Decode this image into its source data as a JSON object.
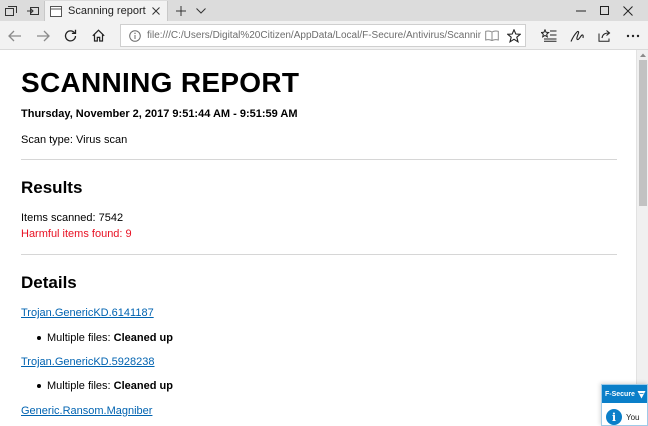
{
  "browser": {
    "tab_title": "Scanning report",
    "address_url": "file:///C:/Users/Digital%20Citizen/AppData/Local/F-Secure/Antivirus/ScanningReports/scan_"
  },
  "report": {
    "title": "SCANNING REPORT",
    "datetime": "Thursday, November 2, 2017 9:51:44 AM - 9:51:59 AM",
    "scan_type": "Scan type: Virus scan",
    "results": {
      "heading": "Results",
      "items_scanned": "Items scanned: 7542",
      "harmful_items": "Harmful items found: 9"
    },
    "details": {
      "heading": "Details",
      "threats": [
        {
          "name": "Trojan.GenericKD.6141187",
          "files_label": "Multiple files: ",
          "action": "Cleaned up"
        },
        {
          "name": "Trojan.GenericKD.5928238",
          "files_label": "Multiple files: ",
          "action": "Cleaned up"
        },
        {
          "name": "Generic.Ransom.Magniber"
        }
      ]
    }
  },
  "toast": {
    "brand": "F-Secure",
    "text": "You"
  },
  "colors": {
    "harmful": "#e81123",
    "link": "#0063b1",
    "toast_accent": "#0a7fc9"
  }
}
